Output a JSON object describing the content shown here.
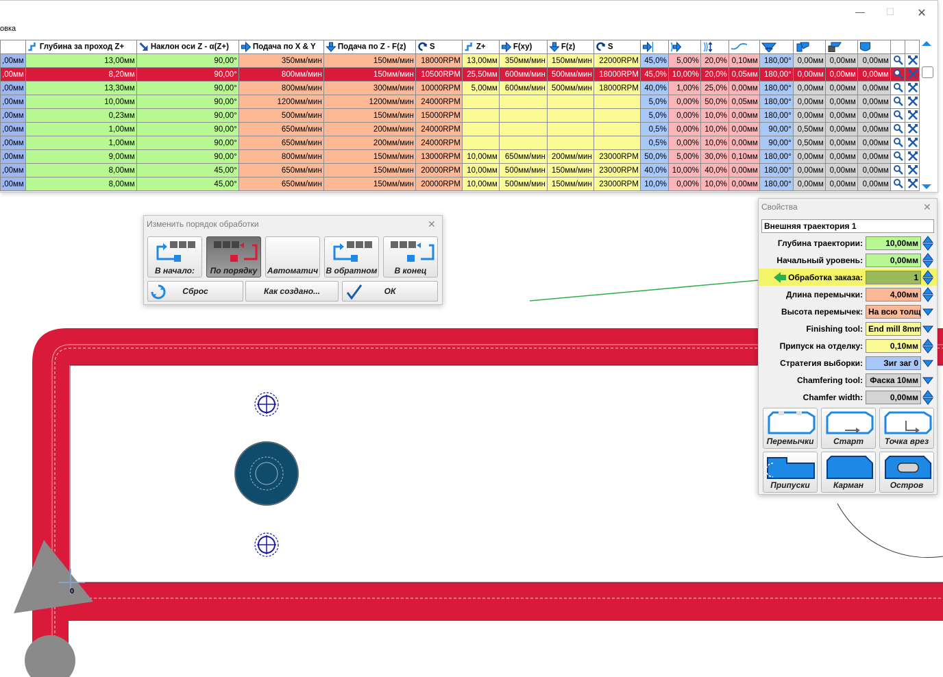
{
  "table": {
    "title_fragment": "овка",
    "columns": [
      {
        "label": "",
        "icon": ""
      },
      {
        "label": "Глубина за проход Z+",
        "icon": "depth-step-icon"
      },
      {
        "label": "Наклон оси Z - α(Z+)",
        "icon": "tilt-arrow-icon"
      },
      {
        "label": "Подача по X & Y",
        "icon": "arrow-right-icon"
      },
      {
        "label": "Подача по Z - F(z)",
        "icon": "arrow-down-icon"
      },
      {
        "label": "S",
        "icon": "rotate-icon"
      },
      {
        "label": "Z+",
        "icon": "depth-step-icon"
      },
      {
        "label": "F(xy)",
        "icon": "arrow-right-icon"
      },
      {
        "label": "F(z)",
        "icon": "arrow-down-icon"
      },
      {
        "label": "S",
        "icon": "rotate-icon"
      },
      {
        "label": "",
        "icon": "arrow-right-bar-icon"
      },
      {
        "label": "",
        "icon": "arrow-right-arc-icon"
      },
      {
        "label": "",
        "icon": "arc-updown-icon"
      },
      {
        "label": "",
        "icon": "wave-icon"
      },
      {
        "label": "",
        "icon": "funnel-icon"
      },
      {
        "label": "",
        "icon": "corner-tool-icon"
      },
      {
        "label": "",
        "icon": "chamfer-tool-icon"
      },
      {
        "label": "",
        "icon": "shield-tool-icon"
      }
    ],
    "rows": [
      {
        "selected": false,
        "cells": [
          ",00мм",
          "13,00мм",
          "90,00°",
          "350мм/мин",
          "150мм/мин",
          "18000RPM",
          "13,00мм",
          "350мм/мин",
          "150мм/мин",
          "22000RPM",
          "45,0%",
          "5,00%",
          "20,0%",
          "0,10мм",
          "180,00°",
          "0,00мм",
          "0,00мм",
          "0,00мм"
        ]
      },
      {
        "selected": true,
        "cells": [
          ",00мм",
          "8,20мм",
          "90,00°",
          "800мм/мин",
          "150мм/мин",
          "10500RPM",
          "25,50мм",
          "600мм/мин",
          "500мм/мин",
          "18000RPM",
          "45,0%",
          "10,00%",
          "20,0%",
          "0,05мм",
          "180,00°",
          "0,00мм",
          "0,00мм",
          "0,00мм"
        ]
      },
      {
        "selected": false,
        "cells": [
          ",00мм",
          "13,30мм",
          "90,00°",
          "800мм/мин",
          "300мм/мин",
          "10000RPM",
          "5,00мм",
          "600мм/мин",
          "500мм/мин",
          "18000RPM",
          "40,0%",
          "1,00%",
          "25,0%",
          "0,00мм",
          "180,00°",
          "0,00мм",
          "0,00мм",
          "0,00мм"
        ]
      },
      {
        "selected": false,
        "cells": [
          ",00мм",
          "10,00мм",
          "90,00°",
          "1200мм/мин",
          "1200мм/мин",
          "24000RPM",
          "",
          "",
          "",
          "",
          "5,0%",
          "0,00%",
          "50,0%",
          "0,05мм",
          "180,00°",
          "0,00мм",
          "0,00мм",
          "0,00мм"
        ]
      },
      {
        "selected": false,
        "cells": [
          ",00мм",
          "0,23мм",
          "90,00°",
          "500мм/мин",
          "150мм/мин",
          "15000RPM",
          "",
          "",
          "",
          "",
          "5,0%",
          "0,00%",
          "10,0%",
          "0,00мм",
          "180,00°",
          "0,00мм",
          "0,00мм",
          "0,00мм"
        ]
      },
      {
        "selected": false,
        "cells": [
          ",00мм",
          "1,00мм",
          "90,00°",
          "650мм/мин",
          "200мм/мин",
          "24000RPM",
          "",
          "",
          "",
          "",
          "0,5%",
          "0,00%",
          "10,0%",
          "0,00мм",
          "90,00°",
          "0,50мм",
          "0,00мм",
          "0,00мм"
        ]
      },
      {
        "selected": false,
        "cells": [
          ",00мм",
          "1,00мм",
          "90,00°",
          "650мм/мин",
          "200мм/мин",
          "24000RPM",
          "",
          "",
          "",
          "",
          "0,5%",
          "0,00%",
          "10,0%",
          "0,00мм",
          "90,00°",
          "0,50мм",
          "0,00мм",
          "0,00мм"
        ]
      },
      {
        "selected": false,
        "cells": [
          ",00мм",
          "9,00мм",
          "90,00°",
          "800мм/мин",
          "150мм/мин",
          "13000RPM",
          "10,00мм",
          "650мм/мин",
          "200мм/мин",
          "23000RPM",
          "50,0%",
          "5,00%",
          "30,0%",
          "0,10мм",
          "180,00°",
          "0,00мм",
          "0,00мм",
          "0,00мм"
        ]
      },
      {
        "selected": false,
        "cells": [
          ",00мм",
          "8,00мм",
          "45,00°",
          "650мм/мин",
          "150мм/мин",
          "20000RPM",
          "10,00мм",
          "500мм/мин",
          "150мм/мин",
          "23000RPM",
          "40,0%",
          "10,00%",
          "40,0%",
          "0,00мм",
          "180,00°",
          "0,00мм",
          "0,00мм",
          "0,00мм"
        ]
      },
      {
        "selected": false,
        "cells": [
          ",00мм",
          "8,00мм",
          "45,00°",
          "650мм/мин",
          "150мм/мин",
          "20000RPM",
          "10,00мм",
          "500мм/мин",
          "150мм/мин",
          "23000RPM",
          "10,0%",
          "0,00%",
          "10,0%",
          "0,00мм",
          "180,00°",
          "0,00мм",
          "0,00мм",
          "0,00мм"
        ]
      }
    ]
  },
  "order_dialog": {
    "title": "Изменить порядок обработки",
    "buttons": [
      {
        "label": "В начало:",
        "active": false
      },
      {
        "label": "По порядку",
        "active": true
      },
      {
        "label": "Автоматич",
        "active": false
      },
      {
        "label": "В обратном",
        "active": false
      },
      {
        "label": "В конец",
        "active": false
      }
    ],
    "bottom": {
      "reset": "Сброс",
      "as_created": "Как создано...",
      "ok": "ОК"
    }
  },
  "properties": {
    "title": "Свойства",
    "name": "Внешняя траектория 1",
    "rows": [
      {
        "label": "Глубина траектории:",
        "value": "10,00мм",
        "color": "#b8f892",
        "control": "spin",
        "align": "right"
      },
      {
        "label": "Начальный уровень:",
        "value": "0,00мм",
        "color": "#b8f892",
        "control": "spin",
        "align": "right"
      },
      {
        "label": "Обработка заказа:",
        "value": "1",
        "color": "#9aba5c",
        "control": "spin",
        "align": "right",
        "highlight": true
      },
      {
        "label": "Длина перемычки:",
        "value": "4,00мм",
        "color": "#fdb996",
        "control": "spin",
        "align": "right"
      },
      {
        "label": "Высота перемычек:",
        "value": "На всю толщ",
        "color": "#fdb996",
        "control": "dropdown",
        "align": "left"
      },
      {
        "label": "Finishing tool:",
        "value": "End mill 8mm",
        "color": "#fbfb96",
        "control": "dropdown",
        "align": "left"
      },
      {
        "label": "Припуск на отделку:",
        "value": "0,10мм",
        "color": "#fbfb96",
        "control": "spin",
        "align": "right"
      },
      {
        "label": "Стратегия выборки:",
        "value": "Зиг заг 0",
        "color": "#a8c8fa",
        "control": "dropdown",
        "align": "right"
      },
      {
        "label": "Chamfering tool:",
        "value": "Фаска 10мм",
        "color": "#d4d4d4",
        "control": "dropdown",
        "align": "right"
      },
      {
        "label": "Chamfer width:",
        "value": "0,00мм",
        "color": "#d4d4d4",
        "control": "spin",
        "align": "right"
      }
    ],
    "buttons": [
      {
        "label": "Перемычки",
        "icon": "bridges-icon"
      },
      {
        "label": "Старт",
        "icon": "start-point-icon"
      },
      {
        "label": "Точка врез",
        "icon": "plunge-point-icon"
      },
      {
        "label": "Припуски",
        "icon": "allowance-icon"
      },
      {
        "label": "Карман",
        "icon": "pocket-icon"
      },
      {
        "label": "Остров",
        "icon": "island-icon"
      }
    ]
  },
  "canvas": {
    "origin_label": "0"
  },
  "colors": {
    "frame": "#d91a3a",
    "accent": "#1e88e5",
    "hole": "#0f4c6c",
    "guide_line": "#2eae4a",
    "highlight": "#f4f46a"
  }
}
